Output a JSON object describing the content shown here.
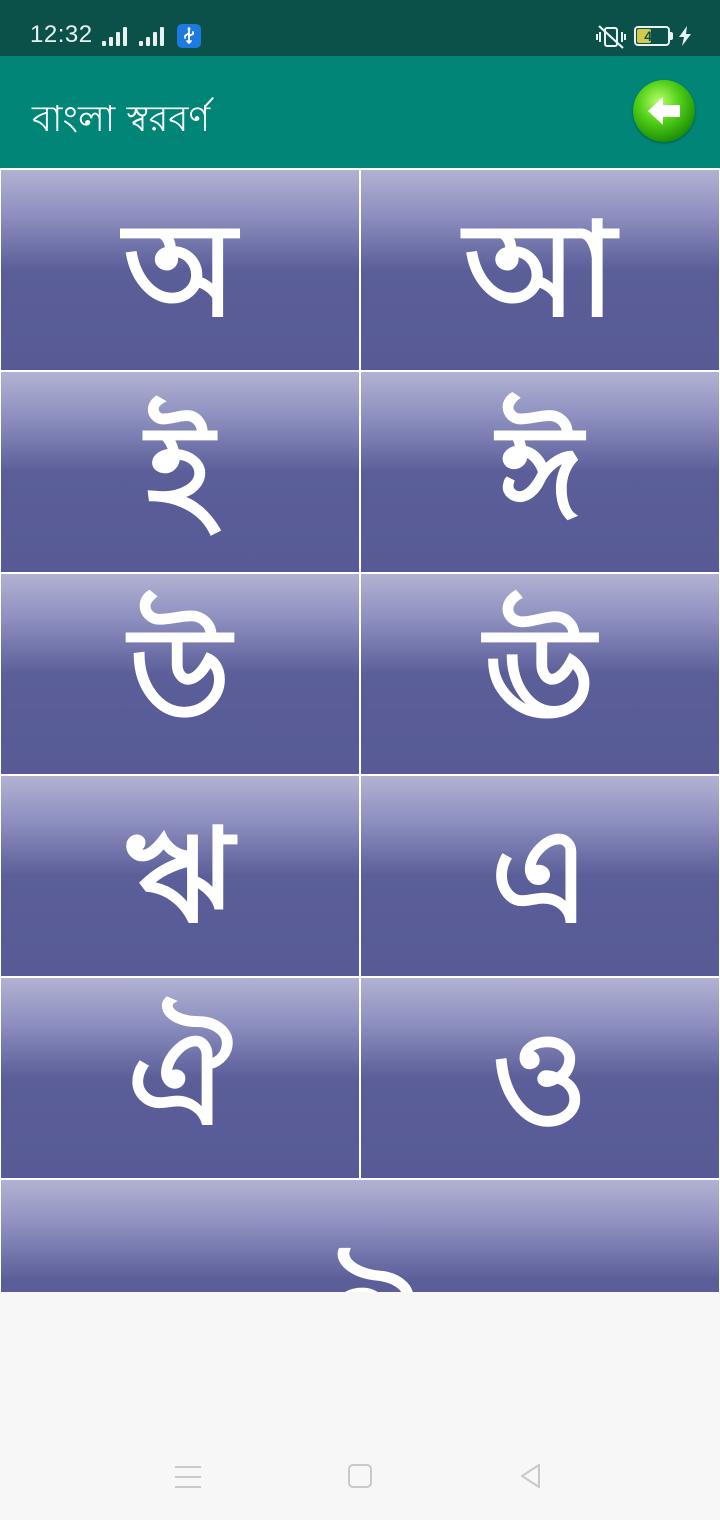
{
  "status_bar": {
    "time": "12:32",
    "icons": [
      "signal-icon",
      "signal-icon",
      "usb-icon",
      "vibrate-off-icon",
      "battery-icon",
      "charging-icon"
    ],
    "battery_level": "46"
  },
  "app_bar": {
    "title": "বাংলা স্বরবর্ণ",
    "back_icon": "back-arrow-icon",
    "accent": "#018576"
  },
  "letters": [
    {
      "letter": "অ"
    },
    {
      "letter": "আ"
    },
    {
      "letter": "ই"
    },
    {
      "letter": "ঈ"
    },
    {
      "letter": "উ"
    },
    {
      "letter": "ঊ"
    },
    {
      "letter": "ঋ"
    },
    {
      "letter": "এ"
    },
    {
      "letter": "ঐ"
    },
    {
      "letter": "ও"
    },
    {
      "letter": "ঔ"
    }
  ],
  "colors": {
    "status_bar": "#0b5149",
    "tile_top": "#b1b2d2",
    "tile_bottom": "#575a96"
  },
  "nav_bar": {
    "icons": [
      "menu-icon",
      "home-icon",
      "back-icon"
    ]
  }
}
